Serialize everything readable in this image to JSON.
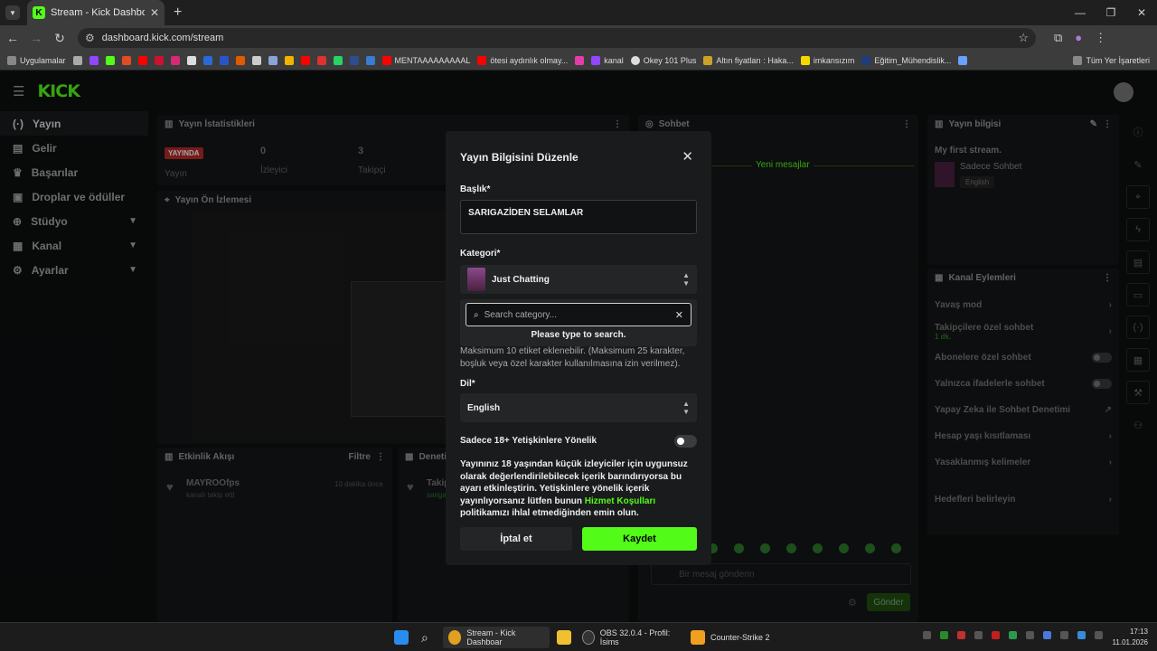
{
  "browser": {
    "tab_title": "Stream - Kick Dashboard",
    "url": "dashboard.kick.com/stream",
    "bookmarks": [
      "Uygulamalar",
      "MENTAAAAAAAAAL",
      "ötesi aydınlık olmay...",
      "kanal",
      "Okey 101 Plus",
      "Altın fiyatları : Haka...",
      "imkansızım",
      "Eğitim_Mühendislik..."
    ],
    "bookmarks_right": "Tüm Yer İşaretleri"
  },
  "sidebar": {
    "items": [
      {
        "label": "Yayın",
        "icon": "broadcast-icon"
      },
      {
        "label": "Gelir",
        "icon": "money-icon"
      },
      {
        "label": "Başarılar",
        "icon": "trophy-icon"
      },
      {
        "label": "Droplar ve ödüller",
        "icon": "gift-icon"
      },
      {
        "label": "Stüdyo",
        "icon": "studio-icon"
      },
      {
        "label": "Kanal",
        "icon": "channel-icon"
      },
      {
        "label": "Ayarlar",
        "icon": "settings-icon"
      }
    ]
  },
  "stats": {
    "title": "Yayın İstatistikleri",
    "live": "YAYINDA",
    "live_sub": "Yayın",
    "viewers": "0",
    "viewers_label": "İzleyici",
    "followers": "3",
    "followers_label": "Takipçi"
  },
  "preview": {
    "title": "Yayın Ön İzlemesi"
  },
  "activity": {
    "title": "Etkinlik Akışı",
    "filter": "Filtre",
    "user": "MAYROOfps",
    "sub": "kanalı takip etti",
    "time": "10 dakika önce"
  },
  "moderation": {
    "title": "Denetim",
    "item": "Takip",
    "item_sub": "sarigaz"
  },
  "chat": {
    "title": "Sohbet",
    "new_messages": "Yeni mesajlar",
    "placeholder": "Bir mesaj gönderin",
    "send": "Gönder"
  },
  "streaminfo": {
    "title": "Yayın bilgisi",
    "stream_title": "My first stream.",
    "category": "Sadece Sohbet",
    "language": "English"
  },
  "channel_actions": {
    "title": "Kanal Eylemleri",
    "items": [
      {
        "label": "Yavaş mod"
      },
      {
        "label": "Takipçilere özel sohbet",
        "sub": "1 dk."
      },
      {
        "label": "Abonelere özel sohbet"
      },
      {
        "label": "Yalnızca ifadelerle sohbet"
      },
      {
        "label": "Yapay Zeka ile Sohbet Denetimi"
      },
      {
        "label": "Hesap yaşı kısıtlaması"
      },
      {
        "label": "Yasaklanmış kelimeler"
      },
      {
        "label": "Hedefleri belirleyin"
      }
    ]
  },
  "modal": {
    "title": "Yayın Bilgisini Düzenle",
    "title_label": "Başlık*",
    "title_value": "SARIGAZİDEN SELAMLAR",
    "category_label": "Kategori*",
    "category_value": "Just Chatting",
    "search_placeholder": "Search category...",
    "search_hint": "Please type to search.",
    "tags_hint": "Maksimum 10 etiket eklenebilir. (Maksimum 25 karakter, boşluk veya özel karakter kullanılmasına izin verilmez).",
    "language_label": "Dil*",
    "language_value": "English",
    "adult_label": "Sadece 18+ Yetişkinlere Yönelik",
    "warning_pre": "Yayınınız 18 yaşından küçük izleyiciler için uygunsuz olarak değerlendirilebilecek içerik barındırıyorsa bu ayarı etkinleştirin. Yetişkinlere yönelik içerik yayınlıyorsanız lütfen bunun ",
    "warning_link": "Hizmet Koşulları",
    "warning_post": " politikamızı ihlal etmediğinden emin olun.",
    "cancel": "İptal et",
    "save": "Kaydet"
  },
  "taskbar": {
    "items": [
      {
        "label": "Stream - Kick Dashboar"
      },
      {
        "label": "OBS 32.0.4 - Profil: İsims"
      },
      {
        "label": "Counter-Strike 2"
      }
    ],
    "time": "17:13",
    "date": "11.01.2026"
  }
}
